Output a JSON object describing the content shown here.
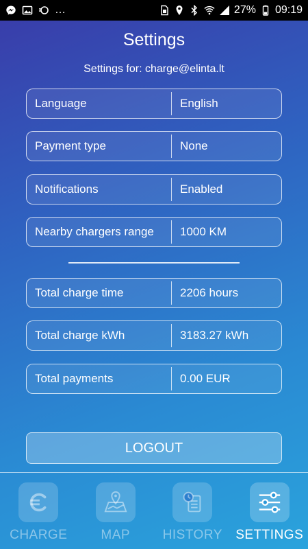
{
  "status": {
    "battery": "27%",
    "time": "09:19",
    "left_icons": [
      "messenger-icon",
      "image-icon",
      "cast-icon",
      "more-dots"
    ],
    "right_icons": [
      "sim-icon",
      "location-icon",
      "bluetooth-icon",
      "wifi-icon",
      "signal-icon",
      "battery-icon"
    ]
  },
  "header": {
    "title": "Settings",
    "subtitle": "Settings for: charge@elinta.lt"
  },
  "settings": [
    {
      "label": "Language",
      "value": "English"
    },
    {
      "label": "Payment type",
      "value": "None"
    },
    {
      "label": "Notifications",
      "value": "Enabled"
    },
    {
      "label": "Nearby chargers range",
      "value": "1000 KM"
    }
  ],
  "stats": [
    {
      "label": "Total charge time",
      "value": "2206 hours"
    },
    {
      "label": "Total charge kWh",
      "value": "3183.27 kWh"
    },
    {
      "label": "Total payments",
      "value": "0.00 EUR"
    }
  ],
  "logout_label": "LOGOUT",
  "tabs": [
    {
      "label": "CHARGE",
      "icon": "charge-icon",
      "active": false
    },
    {
      "label": "MAP",
      "icon": "map-icon",
      "active": false
    },
    {
      "label": "HISTORY",
      "icon": "history-icon",
      "active": false
    },
    {
      "label": "SETTINGS",
      "icon": "sliders-icon",
      "active": true
    }
  ],
  "colors": {
    "gradient_start": "#3a3aa8",
    "gradient_end": "#2aa3dc",
    "text": "#ffffff"
  }
}
